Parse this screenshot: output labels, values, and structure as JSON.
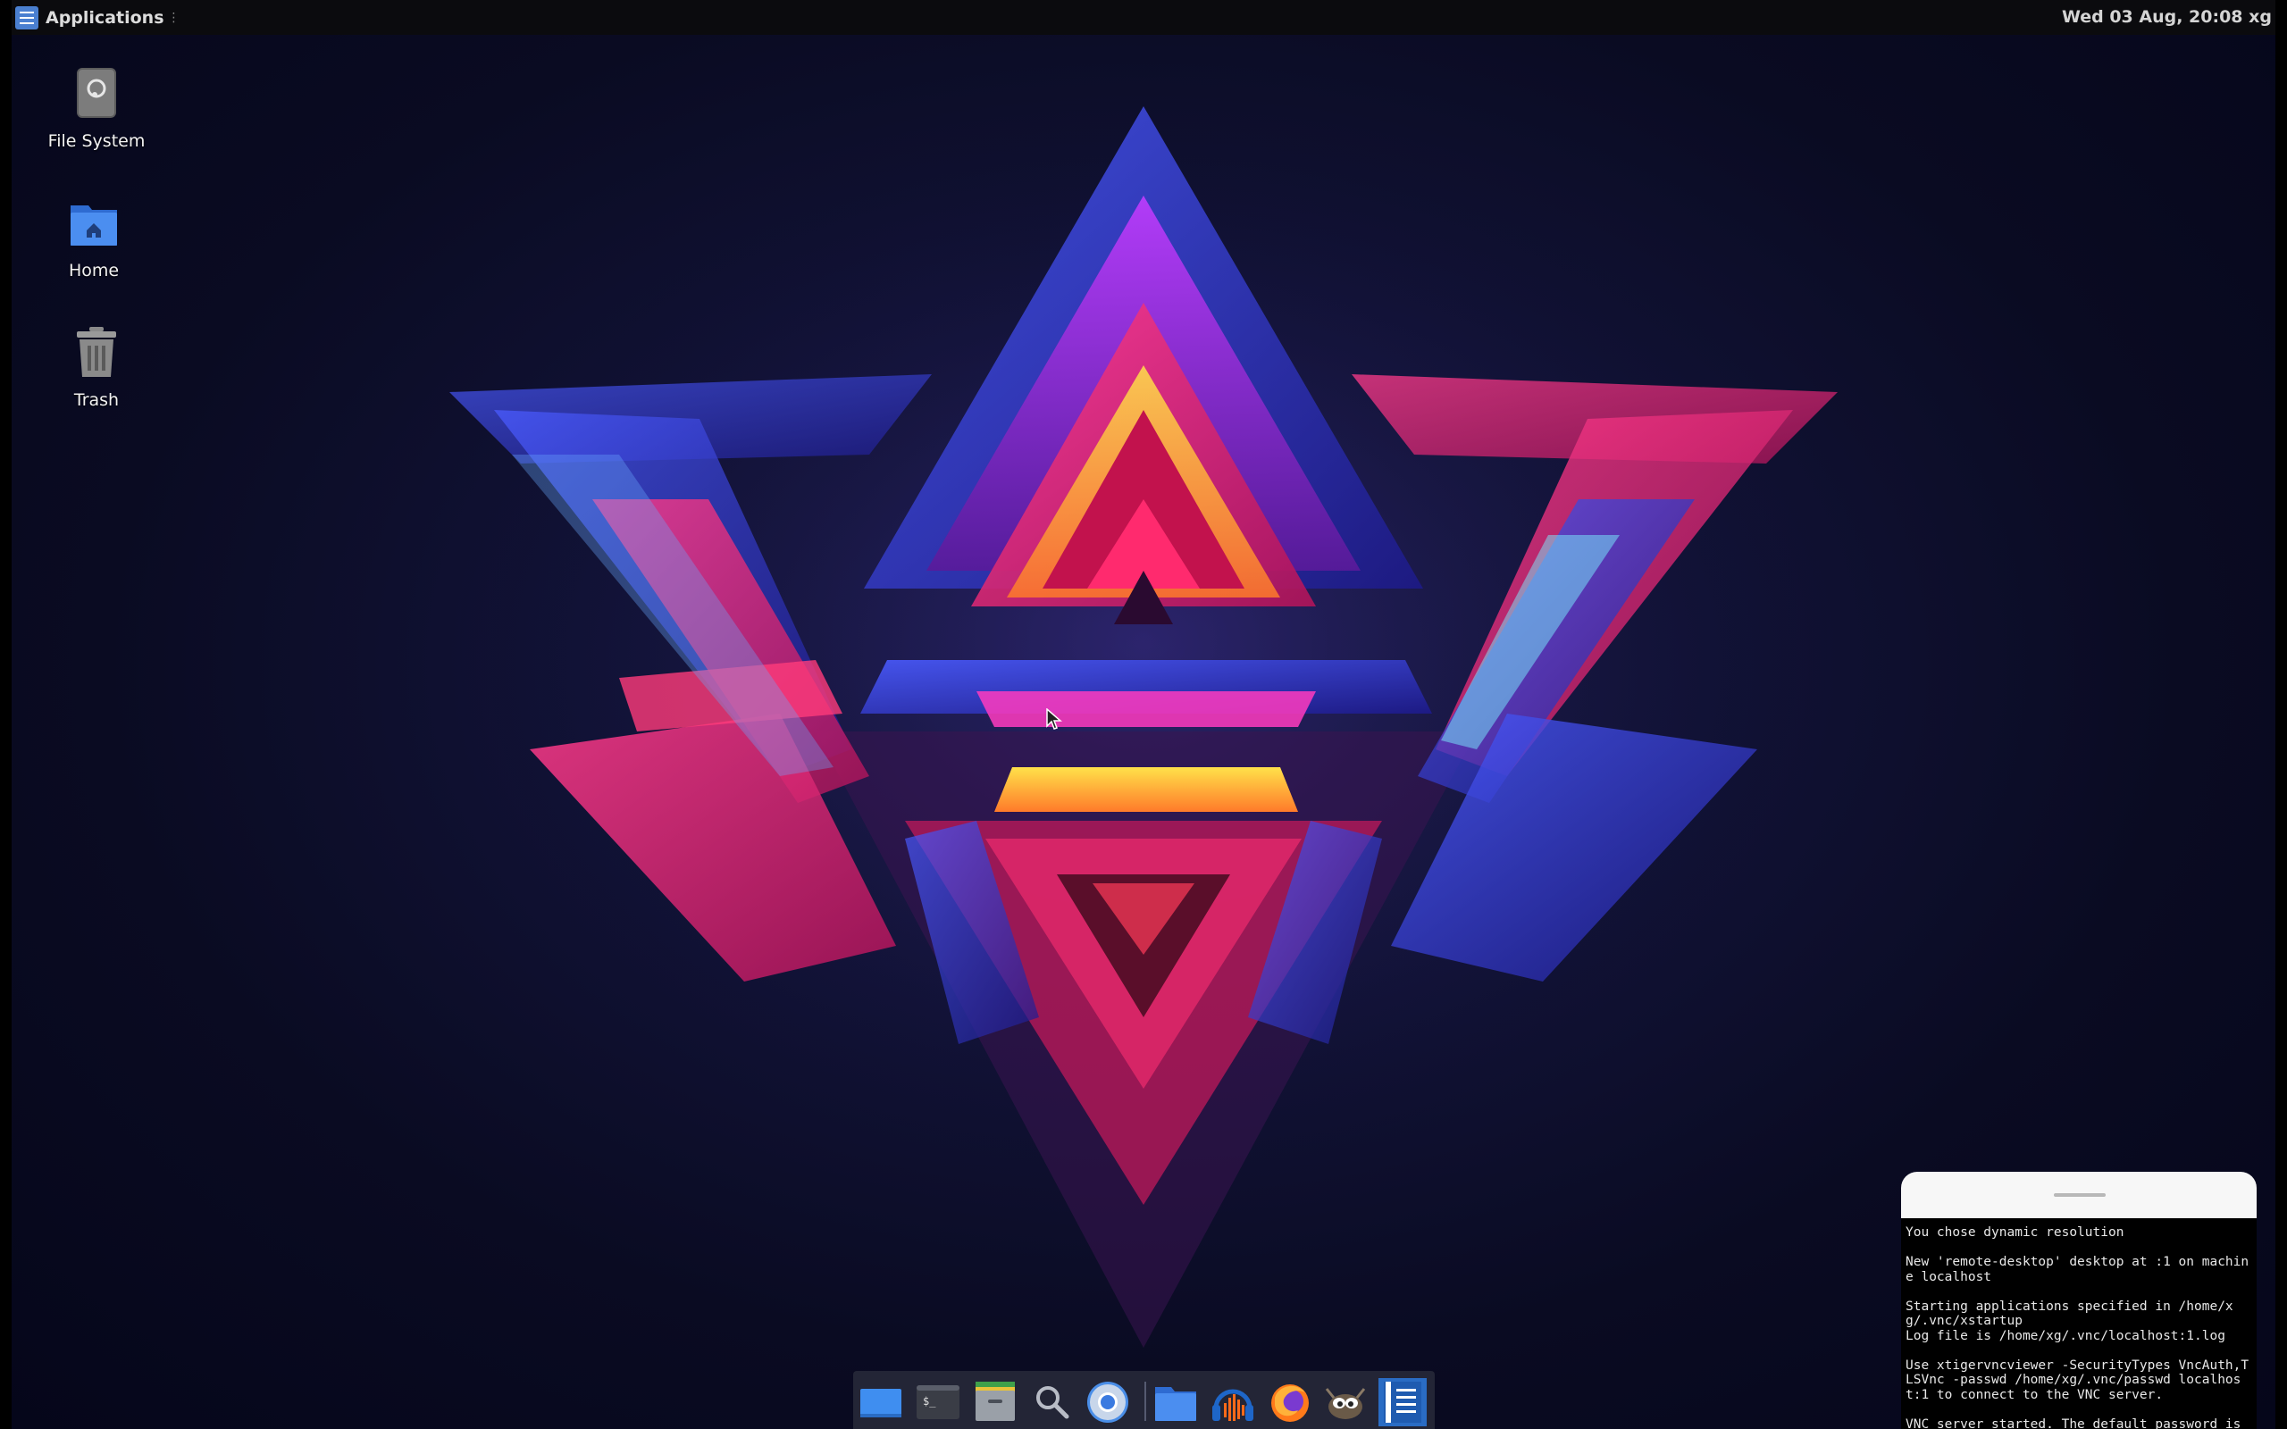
{
  "top_panel": {
    "applications_label": "Applications",
    "handle_glyph": "⋮",
    "clock": "Wed 03 Aug, 20:08 xg"
  },
  "desktop_icons": [
    {
      "label": "File System",
      "icon": "drive-icon"
    },
    {
      "label": "Home",
      "icon": "home-folder-icon"
    },
    {
      "label": "Trash",
      "icon": "trash-icon"
    }
  ],
  "dock": {
    "items": [
      {
        "name": "show-desktop",
        "icon": "show-desktop-icon"
      },
      {
        "name": "terminal",
        "icon": "terminal-icon",
        "glyph": "$_"
      },
      {
        "name": "file-manager",
        "icon": "file-manager-icon"
      },
      {
        "name": "search",
        "icon": "search-icon"
      },
      {
        "name": "chromium",
        "icon": "chromium-icon"
      },
      {
        "name": "files",
        "icon": "folder-icon"
      },
      {
        "name": "audacity",
        "icon": "audacity-icon"
      },
      {
        "name": "firefox",
        "icon": "firefox-icon"
      },
      {
        "name": "gimp",
        "icon": "gimp-icon"
      },
      {
        "name": "text-editor",
        "icon": "text-editor-icon"
      }
    ]
  },
  "vnc_log": {
    "lines": [
      "You chose dynamic resolution",
      "New 'remote-desktop' desktop at :1 on machine localhost",
      "Starting applications specified in /home/xg/.vnc/xstartup\nLog file is /home/xg/.vnc/localhost:1.log",
      "Use xtigervncviewer -SecurityTypes VncAuth,TLSVnc -passwd /home/xg/.vnc/passwd localhost:1 to connect to the VNC server.",
      "VNC server started. The default password is the"
    ]
  },
  "colors": {
    "panel_bg": "#0b0b0e",
    "accent_blue": "#4a7fd0",
    "wallpaper_pink": "#ff2f7a",
    "wallpaper_blue": "#3a3dff",
    "wallpaper_yellow": "#ffc83a"
  }
}
